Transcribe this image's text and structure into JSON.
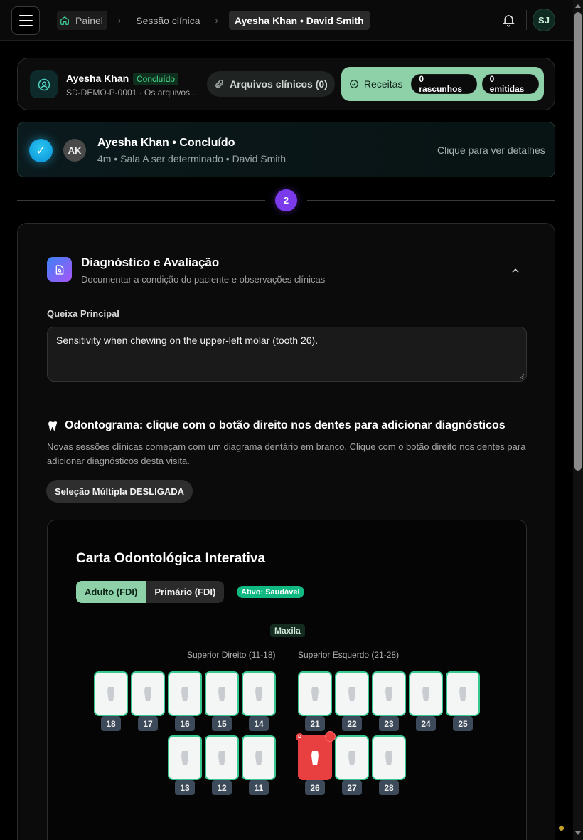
{
  "topbar": {
    "breadcrumbs": [
      "Painel",
      "Sessão clínica",
      "Ayesha Khan • David Smith"
    ],
    "user_initials": "SJ"
  },
  "patient": {
    "name": "Ayesha Khan",
    "status": "Concluído",
    "id_line": "SD-DEMO-P-0001 · Os arquivos ...",
    "files_label": "Arquivos clínicos (0)",
    "rx_label": "Receitas",
    "rx_drafts": "0 rascunhos",
    "rx_issued": "0 emitidas"
  },
  "session": {
    "avatar_initials": "AK",
    "title": "Ayesha Khan • Concluído",
    "meta": "4m • Sala A ser determinado • David Smith",
    "link": "Clique para ver detalhes"
  },
  "step": {
    "number": "2"
  },
  "diagnosis": {
    "title": "Diagnóstico e Avaliação",
    "subtitle": "Documentar a condição do paciente e observações clínicas",
    "complaint_label": "Queixa Principal",
    "complaint_value": "Sensitivity when chewing on the upper-left molar (tooth 26).",
    "odontogram_title": "Odontograma: clique com o botão direito nos dentes para adicionar diagnósticos",
    "odontogram_desc": "Novas sessões clínicas começam com um diagrama dentário em branco. Clique com o botão direito nos dentes para adicionar diagnósticos desta visita.",
    "multi_select_label": "Seleção Múltipla DESLIGADA"
  },
  "chart": {
    "title": "Carta Odontológica Interativa",
    "tab_adult": "Adulto (FDI)",
    "tab_primary": "Primário (FDI)",
    "active_status": "Ativo: Saudável",
    "arch_label": "Maxila",
    "quad_right": "Superior Direito (11-18)",
    "quad_left": "Superior Esquerdo (21-28)",
    "upper_right_row1": [
      "18",
      "17",
      "16",
      "15",
      "14"
    ],
    "upper_right_row2": [
      "13",
      "12",
      "11"
    ],
    "upper_left_row1": [
      "21",
      "22",
      "23",
      "24",
      "25"
    ],
    "upper_left_row2": [
      "26",
      "27",
      "28"
    ],
    "selected_tooth": "26",
    "selected_marker": "D",
    "colors": {
      "healthy_border": "#35c990",
      "selected": "#e84040",
      "accent": "#8ed0a8"
    }
  },
  "icons": {
    "home": "home-icon",
    "bell": "bell-icon",
    "menu": "menu-icon",
    "user": "user-circle-icon",
    "paperclip": "paperclip-icon",
    "check": "check-circle-icon",
    "diagnosis": "file-search-icon",
    "chevron": "chevron-up-icon",
    "tooth": "tooth-icon"
  }
}
